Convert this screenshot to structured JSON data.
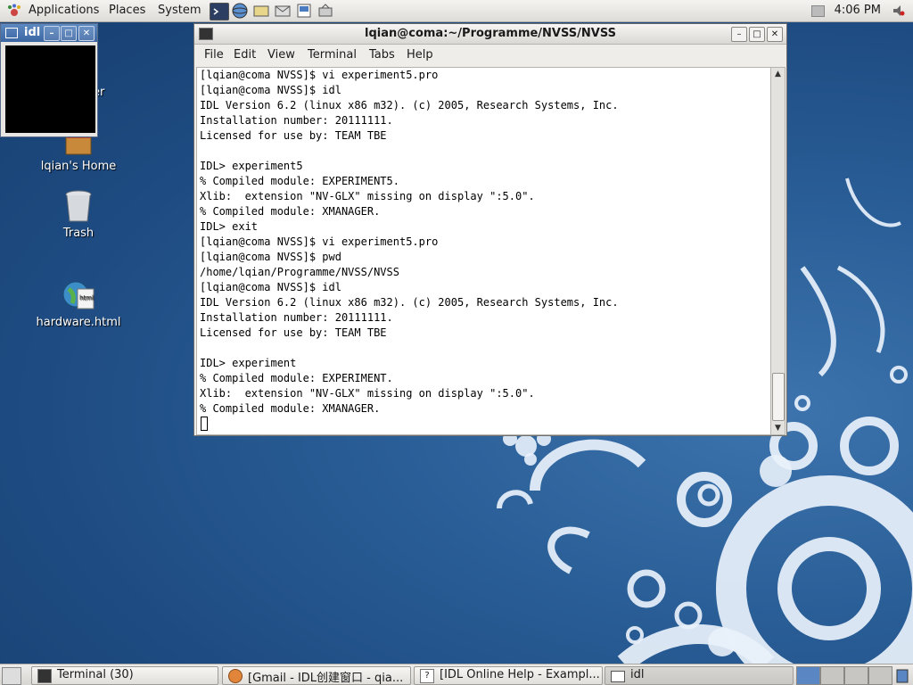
{
  "top_panel": {
    "menus": [
      "Applications",
      "Places",
      "System"
    ],
    "launchers": [
      "terminal-icon",
      "browser-icon",
      "notes-icon",
      "mail-icon",
      "editor-icon",
      "network-icon"
    ],
    "clock": "4:06 PM"
  },
  "desktop_icons": [
    {
      "label": "lqian's Home",
      "icon": "home-folder-icon"
    },
    {
      "label": "Trash",
      "icon": "trash-icon"
    },
    {
      "label": "hardware.html",
      "icon": "html-file-icon"
    }
  ],
  "partial_icon_label": "er",
  "idl_window": {
    "title": "idl"
  },
  "terminal": {
    "title": "lqian@coma:~/Programme/NVSS/NVSS",
    "menus": [
      "File",
      "Edit",
      "View",
      "Terminal",
      "Tabs",
      "Help"
    ],
    "lines": [
      "[lqian@coma NVSS]$ vi experiment5.pro",
      "[lqian@coma NVSS]$ idl",
      "IDL Version 6.2 (linux x86 m32). (c) 2005, Research Systems, Inc.",
      "Installation number: 20111111.",
      "Licensed for use by: TEAM TBE",
      "",
      "IDL> experiment5",
      "% Compiled module: EXPERIMENT5.",
      "Xlib:  extension \"NV-GLX\" missing on display \":5.0\".",
      "% Compiled module: XMANAGER.",
      "IDL> exit",
      "[lqian@coma NVSS]$ vi experiment5.pro",
      "[lqian@coma NVSS]$ pwd",
      "/home/lqian/Programme/NVSS/NVSS",
      "[lqian@coma NVSS]$ idl",
      "IDL Version 6.2 (linux x86 m32). (c) 2005, Research Systems, Inc.",
      "Installation number: 20111111.",
      "Licensed for use by: TEAM TBE",
      "",
      "IDL> experiment",
      "% Compiled module: EXPERIMENT.",
      "Xlib:  extension \"NV-GLX\" missing on display \":5.0\".",
      "% Compiled module: XMANAGER."
    ]
  },
  "taskbar": {
    "tasks": [
      {
        "label": "Terminal (30)",
        "icon": "terminal-icon"
      },
      {
        "label": "[Gmail - IDL创建窗口 - qia...",
        "icon": "firefox-icon"
      },
      {
        "label": "[IDL Online Help - Exampl...",
        "icon": "help-icon"
      },
      {
        "label": "idl",
        "icon": "window-icon"
      }
    ],
    "workspaces": 4
  }
}
